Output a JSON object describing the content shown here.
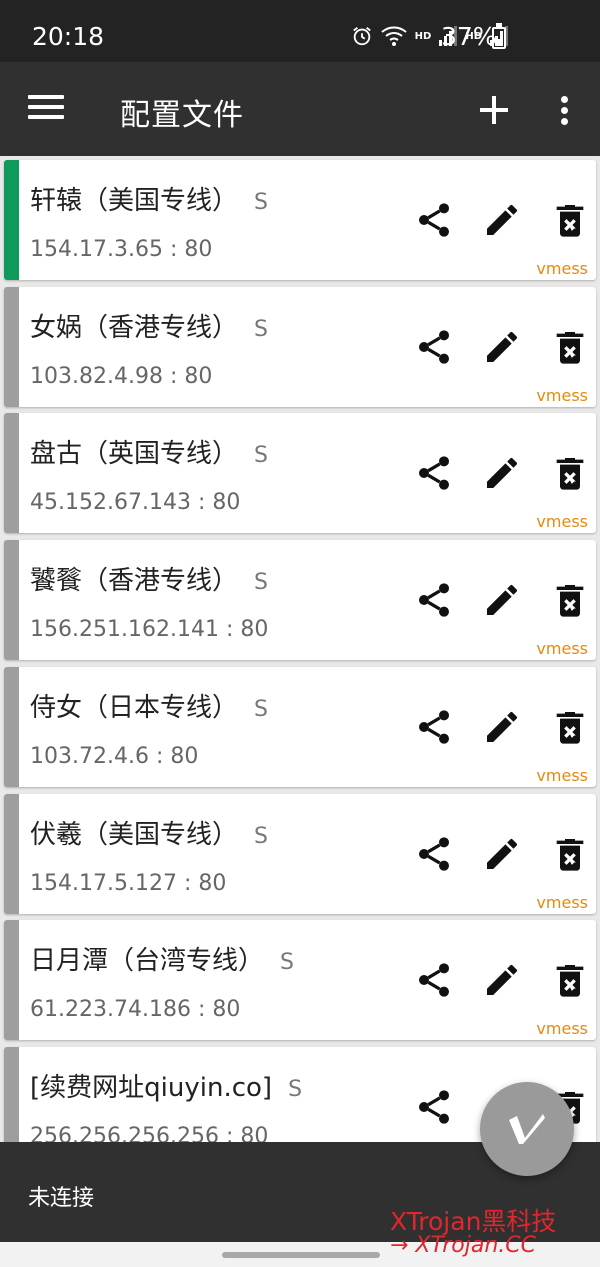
{
  "status_bar": {
    "time": "20:18",
    "hd1": "HD",
    "hd2": "HD",
    "battery": "37%",
    "battery_level": 0.37
  },
  "toolbar": {
    "title": "配置文件",
    "add_icon": "plus-icon",
    "more_icon": "more-vert-icon",
    "menu_icon": "hamburger-menu-icon"
  },
  "servers": [
    {
      "name": "轩辕（美国专线）",
      "tag": "S",
      "address": "154.17.3.65 : 80",
      "protocol": "vmess",
      "active": true
    },
    {
      "name": "女娲（香港专线）",
      "tag": "S",
      "address": "103.82.4.98 : 80",
      "protocol": "vmess",
      "active": false
    },
    {
      "name": "盘古（英国专线）",
      "tag": "S",
      "address": "45.152.67.143 : 80",
      "protocol": "vmess",
      "active": false
    },
    {
      "name": "饕餮（香港专线）",
      "tag": "S",
      "address": "156.251.162.141 : 80",
      "protocol": "vmess",
      "active": false
    },
    {
      "name": "侍女（日本专线）",
      "tag": "S",
      "address": "103.72.4.6 : 80",
      "protocol": "vmess",
      "active": false
    },
    {
      "name": "伏羲（美国专线）",
      "tag": "S",
      "address": "154.17.5.127 : 80",
      "protocol": "vmess",
      "active": false
    },
    {
      "name": "日月潭（台湾专线）",
      "tag": "S",
      "address": "61.223.74.186 : 80",
      "protocol": "vmess",
      "active": false
    },
    {
      "name": "[续费网址qiuyin.co]",
      "tag": "S",
      "address": "256.256.256.256 : 80",
      "protocol": "",
      "active": false
    }
  ],
  "bottom": {
    "connection_status": "未连接",
    "watermark_line1": "XTrojan黑科技",
    "watermark_line2": "→ XTrojan.CC"
  },
  "colors": {
    "active_accent": "#0d9a5a",
    "inactive_accent": "#9e9e9e",
    "protocol_text": "#e38a10",
    "toolbar": "#303030"
  }
}
